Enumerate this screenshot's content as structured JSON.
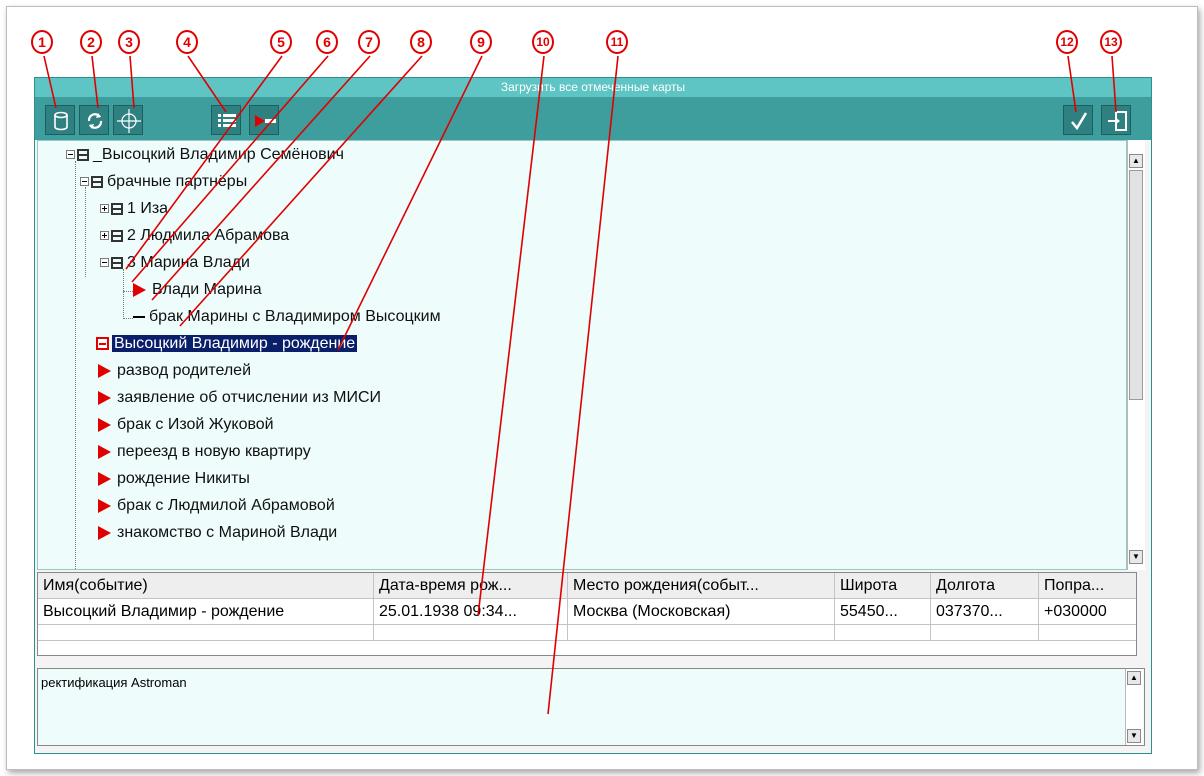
{
  "callouts": [
    "1",
    "2",
    "3",
    "4",
    "5",
    "6",
    "7",
    "8",
    "9",
    "10",
    "11",
    "12",
    "13"
  ],
  "window": {
    "title": "Загрузить все отмеченные карты"
  },
  "toolbar": {
    "buttons": [
      {
        "name": "database-icon"
      },
      {
        "name": "refresh-icon"
      },
      {
        "name": "crosshair-icon"
      },
      {
        "name": "list-icon"
      },
      {
        "name": "collapse-icon"
      },
      {
        "name": "check-icon"
      },
      {
        "name": "exit-icon"
      }
    ]
  },
  "tree": {
    "nodes": [
      {
        "label": "_Высоцкий Владимир Семёнович",
        "level": 0,
        "kind": "group-expanded"
      },
      {
        "label": "брачные партнёры",
        "level": 1,
        "kind": "group-expanded"
      },
      {
        "label": "1 Иза",
        "level": 2,
        "kind": "group-collapsed"
      },
      {
        "label": "2 Людмила Абрамова",
        "level": 2,
        "kind": "group-collapsed"
      },
      {
        "label": "3 Марина Влади",
        "level": 2,
        "kind": "group-expanded"
      },
      {
        "label": "Влади Марина",
        "level": 3,
        "kind": "map"
      },
      {
        "label": "брак Марины с Владимиром Высоцким",
        "level": 3,
        "kind": "event"
      },
      {
        "label": "Высоцкий Владимир - рождение",
        "level": 1,
        "kind": "selected"
      },
      {
        "label": "развод родителей",
        "level": 1,
        "kind": "map"
      },
      {
        "label": "заявление об отчислении из МИСИ",
        "level": 1,
        "kind": "map"
      },
      {
        "label": "брак с Изой Жуковой",
        "level": 1,
        "kind": "map"
      },
      {
        "label": "переезд в новую квартиру",
        "level": 1,
        "kind": "map"
      },
      {
        "label": "рождение Никиты",
        "level": 1,
        "kind": "map"
      },
      {
        "label": "брак с Людмилой Абрамовой",
        "level": 1,
        "kind": "map"
      },
      {
        "label": "знакомство с Мариной Влади",
        "level": 1,
        "kind": "map"
      }
    ]
  },
  "table": {
    "columns": [
      "Имя(событие)",
      "Дата-время рож...",
      "Место рождения(событ...",
      "Широта",
      "Долгота",
      "Попра..."
    ],
    "rows": [
      [
        "Высоцкий Владимир - рождение",
        "25.01.1938 09:34...",
        "Москва (Московская)",
        "55450...",
        "037370...",
        "+030000"
      ]
    ]
  },
  "notes": {
    "text": "ректификация Astroman"
  },
  "colors": {
    "teal": "#3e9e9e",
    "selected": "#0a1f6a",
    "marker": "#e00000"
  }
}
